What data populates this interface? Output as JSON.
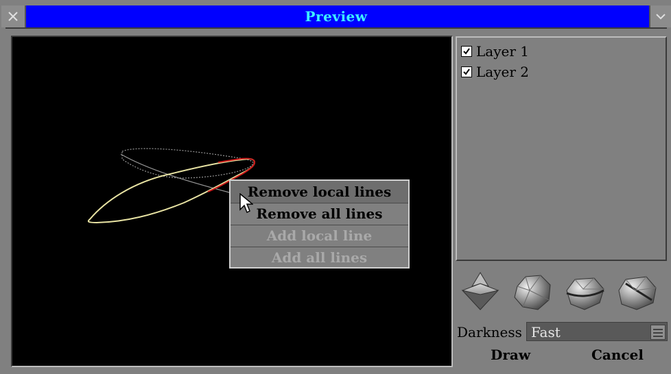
{
  "window": {
    "title": "Preview",
    "close_icon": "close-icon",
    "menu_icon": "chevron-down-icon"
  },
  "layers": [
    {
      "label": "Layer 1",
      "checked": true
    },
    {
      "label": "Layer 2",
      "checked": true
    }
  ],
  "render_modes": [
    {
      "icon": "spinning-top-icon"
    },
    {
      "icon": "rough-rock-icon"
    },
    {
      "icon": "banded-rock-icon"
    },
    {
      "icon": "cracked-rock-icon"
    }
  ],
  "darkness": {
    "label": "Darkness",
    "value": "Fast"
  },
  "buttons": {
    "draw": "Draw",
    "cancel": "Cancel"
  },
  "context_menu": [
    {
      "label": "Remove local lines",
      "enabled": true,
      "highlighted": true
    },
    {
      "label": "Remove all lines",
      "enabled": true,
      "highlighted": false
    },
    {
      "label": "Add local line",
      "enabled": false,
      "highlighted": false
    },
    {
      "label": "Add all lines",
      "enabled": false,
      "highlighted": false
    }
  ],
  "colors": {
    "titlebar": "#0000ff",
    "title_text": "#3df2ff",
    "viewport_bg": "#000000",
    "curve_main": "#e8e3a3",
    "curve_highlight": "#cc1a1a",
    "curve_ghost": "#8a8a8a"
  }
}
